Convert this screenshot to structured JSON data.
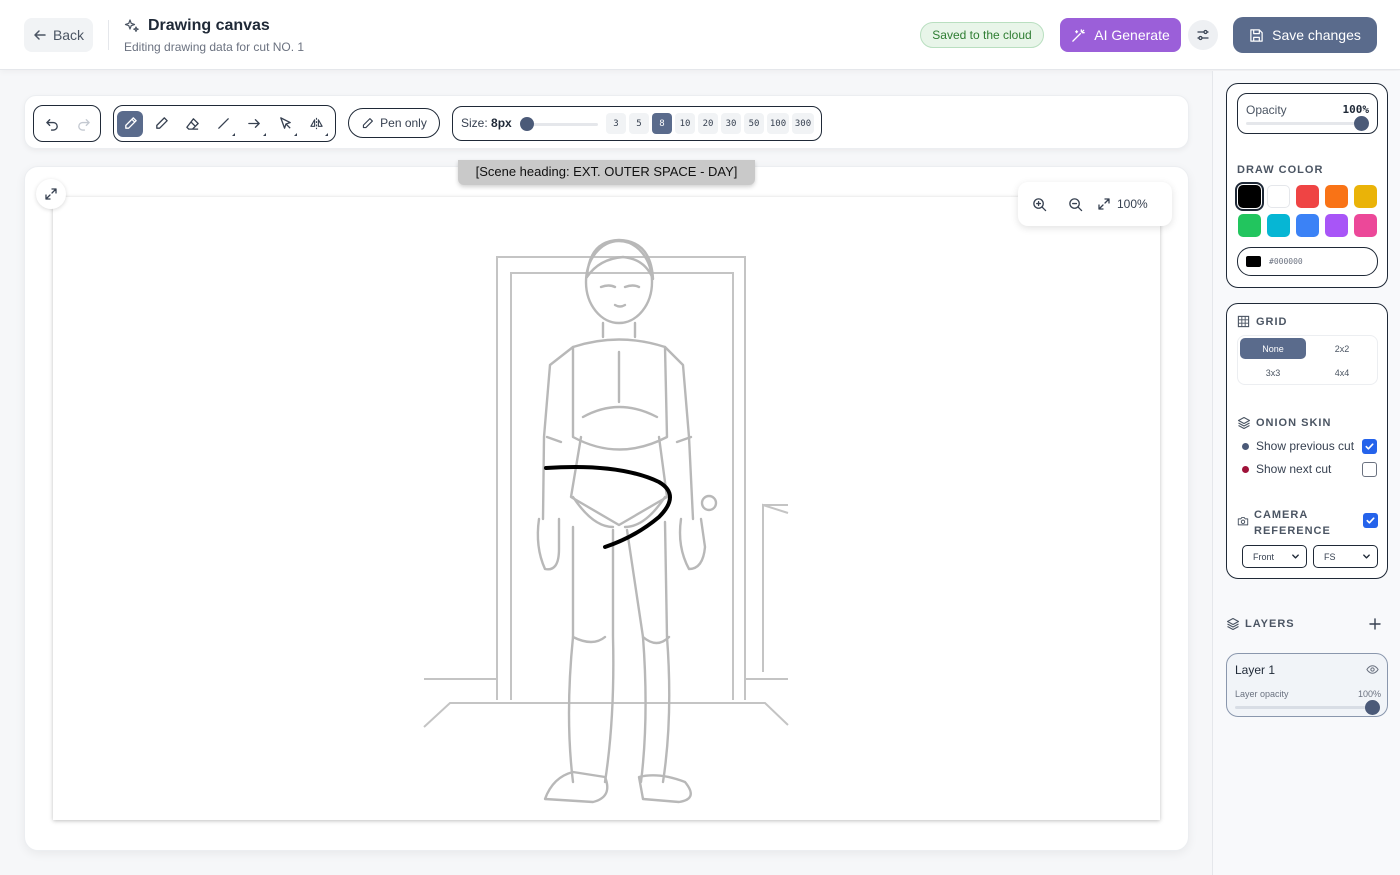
{
  "header": {
    "back_label": "Back",
    "title": "Drawing canvas",
    "subtitle": "Editing drawing data for cut NO. 1",
    "saved_status": "Saved to the cloud",
    "ai_label": "AI Generate",
    "save_label": "Save changes"
  },
  "toolbar": {
    "undo_icon": "undo-icon",
    "redo_icon": "redo-icon",
    "tools": [
      "pen",
      "pencil",
      "eraser",
      "line",
      "arrow",
      "select",
      "mirror"
    ],
    "active_tool": "pen",
    "pen_only_label": "Pen only",
    "size_label": "Size:",
    "size_value": "8px",
    "sizes": [
      "3",
      "5",
      "8",
      "10",
      "20",
      "30",
      "50",
      "100",
      "300"
    ],
    "active_size": "8"
  },
  "canvas": {
    "scene_heading": "[Scene heading: EXT. OUTER SPACE - DAY]",
    "zoom_label": "100%"
  },
  "panel": {
    "opacity_label": "Opacity",
    "opacity_value": "100%",
    "opacity": 1.0,
    "draw_color_title": "DRAW COLOR",
    "colors": [
      "#000000",
      "#ffffff",
      "#ef4444",
      "#f97316",
      "#eab308",
      "#22c55e",
      "#06b6d4",
      "#3b82f6",
      "#a855f7",
      "#ec4899"
    ],
    "selected_color": "#000000",
    "hex_value": "#000000",
    "grid_title": "GRID",
    "grid_options": [
      "None",
      "2x2",
      "3x3",
      "4x4"
    ],
    "grid_selected": "None",
    "onion_title": "ONION SKIN",
    "onion_prev_label": "Show previous cut",
    "onion_prev_checked": true,
    "onion_next_label": "Show next cut",
    "onion_next_checked": false,
    "onion_prev_color": "#4b5a78",
    "onion_next_color": "#9f1239",
    "camera_title_line1": "CAMERA",
    "camera_title_line2": "REFERENCE",
    "camera_checked": true,
    "camera_angle": "Front",
    "camera_shot": "FS",
    "layers_title": "LAYERS",
    "layers": [
      {
        "name": "Layer 1",
        "opacity_label": "Layer opacity",
        "opacity_value": "100%",
        "opacity": 1.0,
        "visible": true
      }
    ]
  }
}
